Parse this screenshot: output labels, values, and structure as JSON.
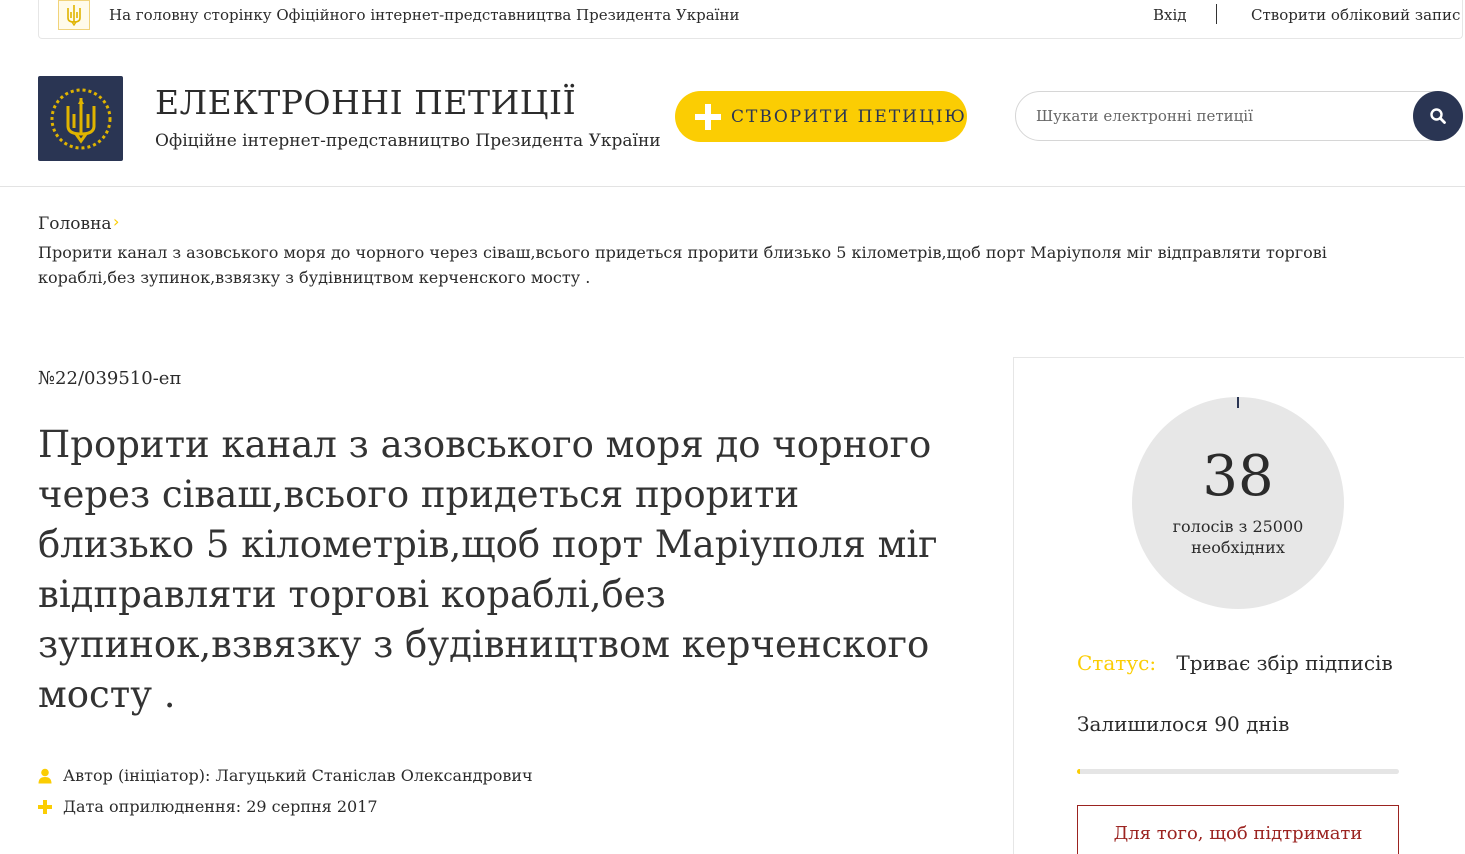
{
  "topbar": {
    "home_link": "На головну сторінку Офіційного інтернет-представництва Президента України",
    "login": "Вхід",
    "register": "Створити обліковий запис"
  },
  "header": {
    "title": "ЕЛЕКТРОННІ ПЕТИЦІЇ",
    "subtitle": "Офіційне інтернет-представництво Президента України",
    "create_button": "СТВОРИТИ ПЕТИЦІЮ",
    "search_placeholder": "Шукати електронні петиції"
  },
  "breadcrumb": {
    "home": "Головна",
    "current": "Прорити канал з азовського моря до чорного через сіваш,всього придеться прорити близько 5 кілометрів,щоб порт Маріуполя міг відправляти торгові кораблі,без зупинок,взвязку з будівництвом керченского мосту ."
  },
  "petition": {
    "number": "№22/039510-еп",
    "title": "Прорити канал з азовського моря до чорного через сіваш,всього придеться прорити близько 5 кілометрів,щоб порт Маріуполя міг відправляти торгові кораблі,без зупинок,взвязку з будівництвом керченского мосту .",
    "author": "Автор (ініціатор): Лагуцький Станіслав Олександрович",
    "date": "Дата оприлюднення: 29 серпня 2017"
  },
  "panel": {
    "votes": "38",
    "votes_of_line1": "голосів з 25000",
    "votes_of_line2": "необхідних",
    "status_label": "Статус:",
    "status_value": "Триває збір підписів",
    "days_left": "Залишилося 90 днів",
    "progress_fraction": 0.0015,
    "support_text": "Для того, щоб підтримати"
  },
  "colors": {
    "accent_yellow": "#fbcd03",
    "navy": "#2a3553",
    "support_red": "#9b2320"
  },
  "icons": {
    "emblem": "trident-icon",
    "search": "search-icon",
    "author": "user-icon",
    "date": "plus-icon",
    "breadcrumb_separator": "chevron-right-icon"
  }
}
